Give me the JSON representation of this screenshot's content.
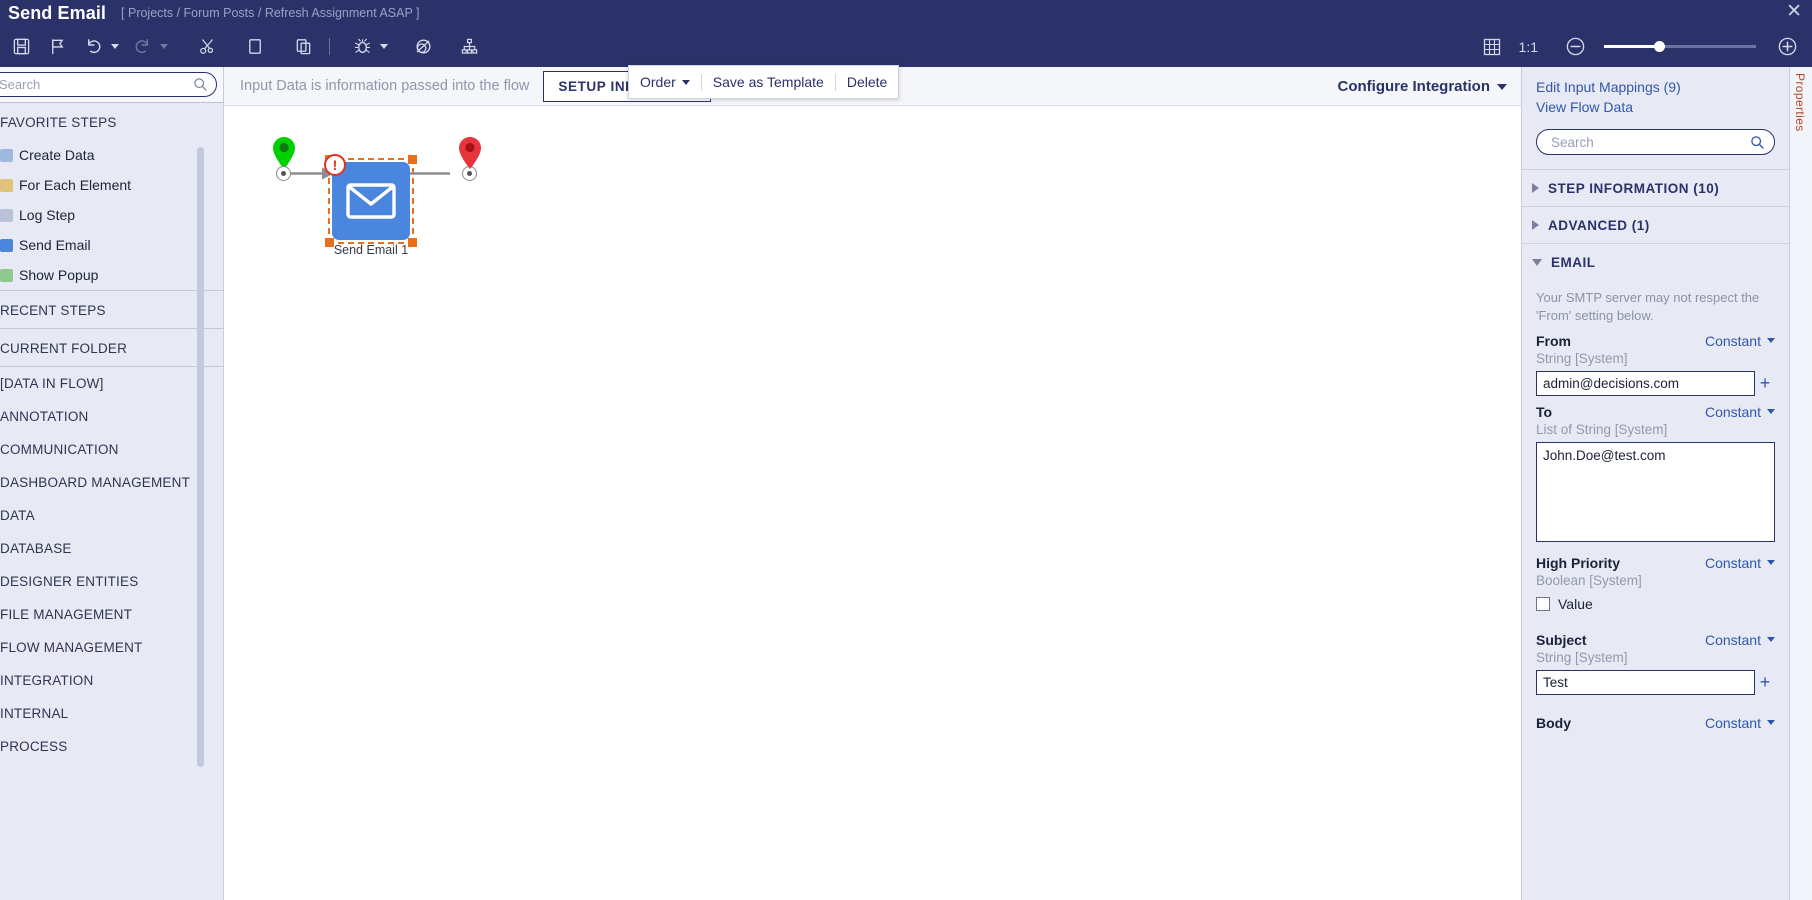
{
  "header": {
    "title": "Send Email",
    "breadcrumb": "[ Projects / Forum Posts / Refresh Assignment ASAP ]",
    "close_label": "✕"
  },
  "toolbar": {
    "icons": [
      {
        "name": "save-icon",
        "label": "Save"
      },
      {
        "name": "flag-icon",
        "label": "Flag"
      },
      {
        "name": "undo-icon",
        "label": "Undo"
      },
      {
        "name": "redo-icon",
        "label": "Redo"
      },
      {
        "name": "cut-icon",
        "label": "Cut"
      },
      {
        "name": "copy-icon",
        "label": "Copy"
      },
      {
        "name": "paste-icon",
        "label": "Paste"
      },
      {
        "name": "debug-icon",
        "label": "Debug"
      },
      {
        "name": "layers-icon",
        "label": "Layers"
      },
      {
        "name": "hierarchy-icon",
        "label": "Hierarchy"
      }
    ],
    "grid_icon": "grid-icon",
    "ratio_label": "1:1",
    "zoom_out_label": "−",
    "zoom_in_label": "+",
    "zoom_value": 36
  },
  "sidebar": {
    "search": {
      "value": "",
      "placeholder": "Search"
    },
    "sections": [
      {
        "title": "FAVORITE STEPS",
        "items": [
          "Create Data",
          "For Each Element",
          "Log Step",
          "Send Email",
          "Show Popup"
        ]
      },
      {
        "title": "RECENT STEPS",
        "items": []
      },
      {
        "title": "CURRENT FOLDER",
        "items": []
      }
    ],
    "categories": [
      "[DATA IN FLOW]",
      "ANNOTATION",
      "COMMUNICATION",
      "DASHBOARD MANAGEMENT",
      "DATA",
      "DATABASE",
      "DESIGNER ENTITIES",
      "FILE MANAGEMENT",
      "FLOW MANAGEMENT",
      "INTEGRATION",
      "INTERNAL",
      "PROCESS"
    ]
  },
  "canvas": {
    "hint": "Input Data is information passed into the flow",
    "setup_button": "SETUP INPUT DATA",
    "configure_integration": "Configure Integration",
    "context_menu": [
      {
        "label": "Order",
        "has_caret": true
      },
      {
        "label": "Save as Template",
        "has_caret": false
      },
      {
        "label": "Delete",
        "has_caret": false
      }
    ],
    "step_label": "Send Email 1",
    "step_warning": "!",
    "start_marker_color": "#00d000",
    "end_marker_color": "#e8343c",
    "step_color": "#4a86de",
    "selection_color": "#e8701a"
  },
  "properties": {
    "tab_label": "Properties",
    "edit_input_mappings": "Edit Input Mappings (9)",
    "view_flow_data": "View Flow Data",
    "search": {
      "value": "",
      "placeholder": "Search"
    },
    "accordions": [
      {
        "name": "step-information",
        "title": "STEP INFORMATION (10)",
        "expanded": false
      },
      {
        "name": "advanced",
        "title": "ADVANCED (1)",
        "expanded": false
      },
      {
        "name": "email",
        "title": "EMAIL",
        "expanded": true
      }
    ],
    "email": {
      "note": "Your SMTP server may not respect the 'From' setting below.",
      "fields": [
        {
          "label": "From",
          "mode": "Constant",
          "type": "String [System]",
          "control": "input",
          "value": "admin@decisions.com",
          "has_plus": true
        },
        {
          "label": "To",
          "mode": "Constant",
          "type": "List of String [System]",
          "control": "textarea",
          "value": "John.Doe@test.com",
          "has_plus": false
        },
        {
          "label": "High Priority",
          "mode": "Constant",
          "type": "Boolean [System]",
          "control": "checkbox",
          "value": "Value",
          "checked": false
        },
        {
          "label": "Subject",
          "mode": "Constant",
          "type": "String [System]",
          "control": "input",
          "value": "Test",
          "has_plus": true
        },
        {
          "label": "Body",
          "mode": "Constant",
          "type": "",
          "control": "none",
          "value": ""
        }
      ]
    }
  },
  "colors": {
    "header_bg": "#2a3269",
    "panel_bg": "#e7eaf4",
    "accent": "#3257a8",
    "orange": "#e8701a",
    "red": "#e03020"
  }
}
